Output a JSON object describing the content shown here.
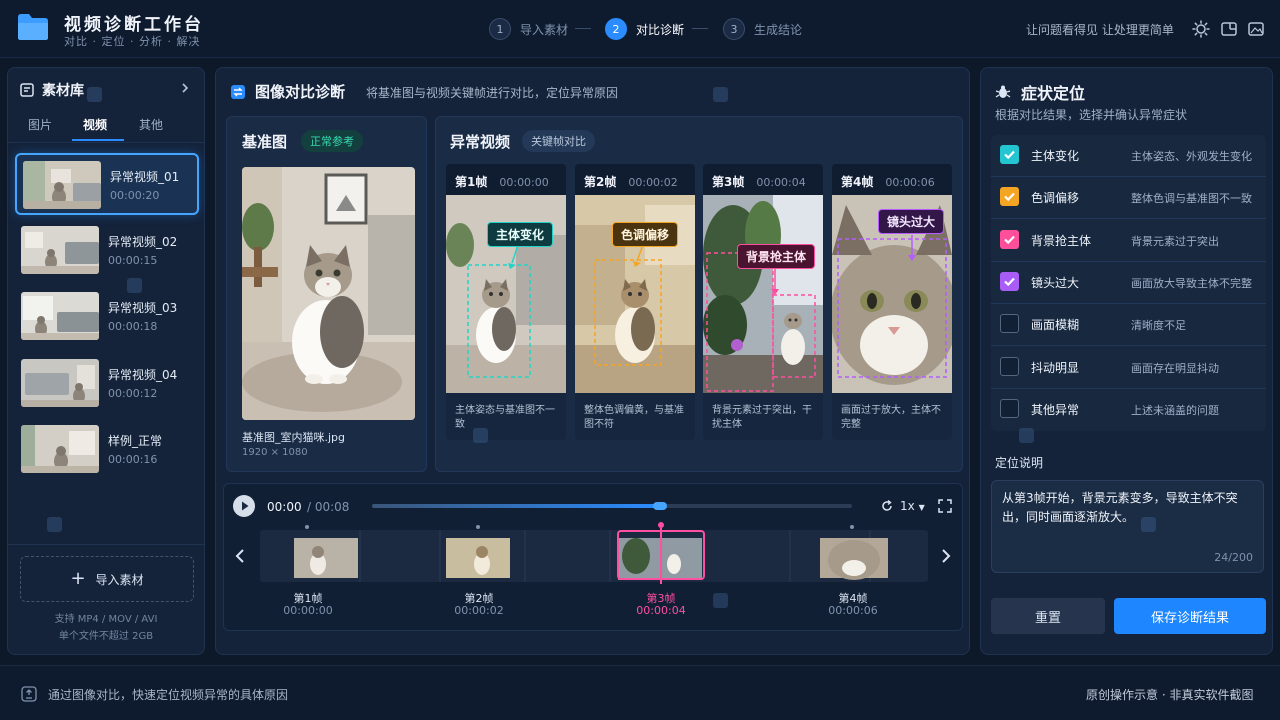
{
  "header": {
    "title": "视频诊断工作台",
    "subtitle": "对比 · 定位 · 分析 · 解决",
    "steps": [
      {
        "num": "1",
        "label": "导入素材"
      },
      {
        "num": "2",
        "label": "对比诊断"
      },
      {
        "num": "3",
        "label": "生成结论"
      }
    ],
    "active_step": 2,
    "slogan": "让问题看得见 让处理更简单",
    "icons": [
      "sun-icon",
      "window-icon",
      "image-icon"
    ]
  },
  "library": {
    "title": "素材库",
    "tabs": [
      "图片",
      "视频",
      "其他"
    ],
    "active_tab": "视频",
    "items": [
      {
        "name": "异常视频_01",
        "time": "00:00:20"
      },
      {
        "name": "异常视频_02",
        "time": "00:00:15"
      },
      {
        "name": "异常视频_03",
        "time": "00:00:18"
      },
      {
        "name": "异常视频_04",
        "time": "00:00:12"
      },
      {
        "name": "样例_正常",
        "time": "00:00:16"
      }
    ],
    "import_label": "导入素材",
    "formats": "支持 MP4 / MOV / AVI",
    "size_limit": "单个文件不超过 2GB"
  },
  "compare": {
    "title": "图像对比诊断",
    "subtitle": "将基准图与视频关键帧进行对比，定位异常原因",
    "base": {
      "title": "基准图",
      "badge": "正常参考",
      "filename": "基准图_室内猫咪.jpg",
      "dims": "1920 × 1080"
    },
    "abnormal": {
      "title": "异常视频",
      "badge": "关键帧对比",
      "frames": [
        {
          "label": "第1帧",
          "time": "00:00:00",
          "tag": "主体变化",
          "caption": "主体姿态与基准图不一致",
          "color": "#23d3c9"
        },
        {
          "label": "第2帧",
          "time": "00:00:02",
          "tag": "色调偏移",
          "caption": "整体色调偏黄，与基准图不符",
          "color": "#f5a524"
        },
        {
          "label": "第3帧",
          "time": "00:00:04",
          "tag": "背景抢主体",
          "caption": "背景元素过于突出，干扰主体",
          "color": "#ff4fa0"
        },
        {
          "label": "第4帧",
          "time": "00:00:06",
          "tag": "镜头过大",
          "caption": "画面过于放大，主体不完整",
          "color": "#b45cff"
        }
      ]
    }
  },
  "player": {
    "current": "00:00",
    "total": "/ 00:08",
    "speed": "1x",
    "progress": 0.6,
    "markers": [
      {
        "label": "第1帧",
        "time": "00:00:00"
      },
      {
        "label": "第2帧",
        "time": "00:00:02"
      },
      {
        "label": "第3帧",
        "time": "00:00:04"
      },
      {
        "label": "第4帧",
        "time": "00:00:06"
      }
    ],
    "active_marker": 2
  },
  "symptoms": {
    "title": "症状定位",
    "subtitle": "根据对比结果，选择并确认异常症状",
    "items": [
      {
        "name": "主体变化",
        "desc": "主体姿态、外观发生变化",
        "checked": true,
        "color": "#23c5d0"
      },
      {
        "name": "色调偏移",
        "desc": "整体色调与基准图不一致",
        "checked": true,
        "color": "#f5a524"
      },
      {
        "name": "背景抢主体",
        "desc": "背景元素过于突出",
        "checked": true,
        "color": "#ff4f9a"
      },
      {
        "name": "镜头过大",
        "desc": "画面放大导致主体不完整",
        "checked": true,
        "color": "#a95cf6"
      },
      {
        "name": "画面模糊",
        "desc": "清晰度不足",
        "checked": false,
        "color": ""
      },
      {
        "name": "抖动明显",
        "desc": "画面存在明显抖动",
        "checked": false,
        "color": ""
      },
      {
        "name": "其他异常",
        "desc": "上述未涵盖的问题",
        "checked": false,
        "color": ""
      }
    ],
    "note_label": "定位说明",
    "note_text": "从第3帧开始，背景元素变多，导致主体不突出，同时画面逐渐放大。",
    "note_count": "24/200",
    "reset_label": "重置",
    "save_label": "保存诊断结果"
  },
  "footer": {
    "hint": "通过图像对比，快速定位视频异常的具体原因",
    "disclaimer": "原创操作示意 · 非真实软件截图"
  }
}
